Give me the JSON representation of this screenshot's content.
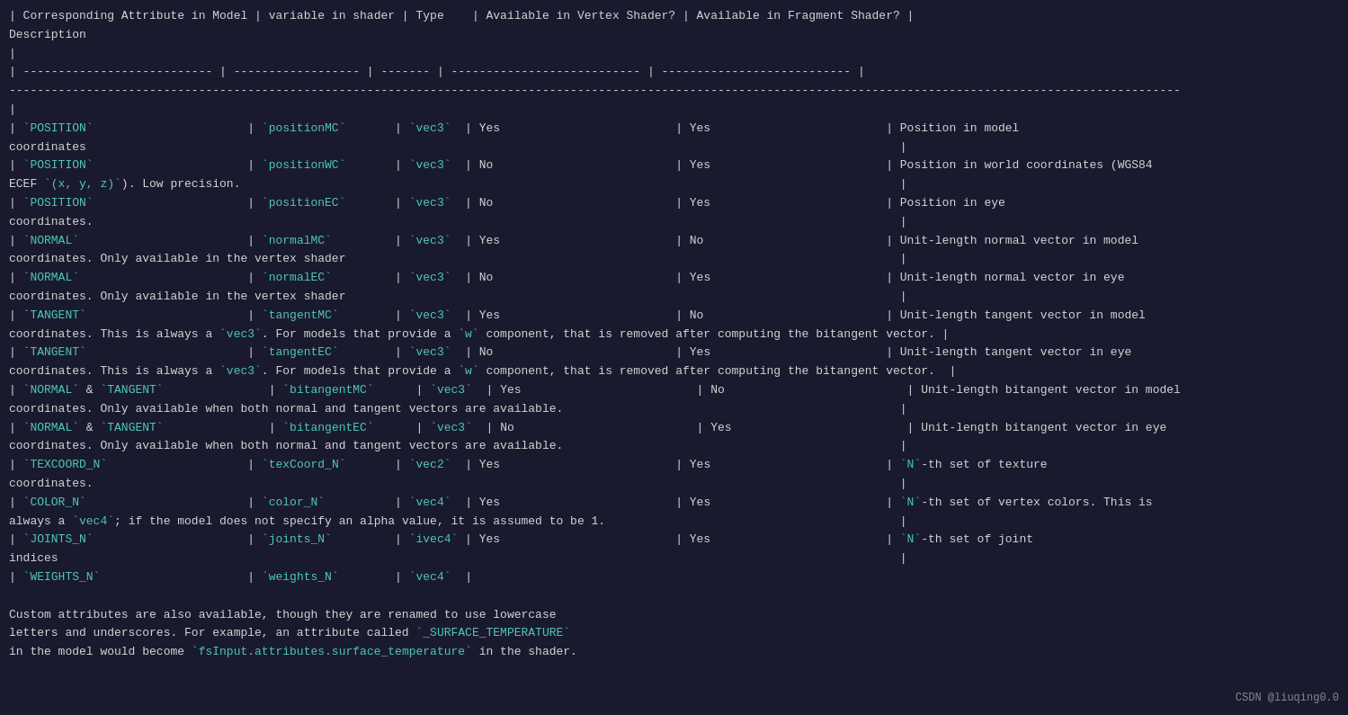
{
  "watermark": "CSDN @liuqing0.0",
  "content": {
    "header": "| Corresponding Attribute in Model | variable in shader | Type    | Available in Vertex Shader? | Available in Fragment Shader? |\nDescription",
    "sep1": "|\n| --------------------------- | ------------------ | ------- | --------------------------- | --------------------------- |",
    "sep2": "-----------------------------------------------------------------------------------------------------------------------------------------------------------------------",
    "blank": "|",
    "rows": [
      {
        "attr": "`POSITION`",
        "shader": "`positionMC`",
        "type": "`vec3`",
        "vertex": "Yes",
        "fragment": "Yes",
        "desc": "| Position in model coordinates                                                                     |"
      },
      {
        "attr": "`POSITION`",
        "shader": "`positionWC`",
        "type": "`vec3`",
        "vertex": "No",
        "fragment": "Yes",
        "desc": "| Position in world coordinates (WGS84 ECEF `(x, y, z)`). Low precision.                           |"
      },
      {
        "attr": "`POSITION`",
        "shader": "`positionEC`",
        "type": "`vec3`",
        "vertex": "No",
        "fragment": "Yes",
        "desc": "| Position in eye coordinates.                                                                      |"
      },
      {
        "attr": "`NORMAL`",
        "shader": "`normalMC`",
        "type": "`vec3`",
        "vertex": "Yes",
        "fragment": "No",
        "desc": "| Unit-length normal vector in model coordinates. Only available in the vertex shader               |"
      },
      {
        "attr": "`NORMAL`",
        "shader": "`normalEC`",
        "type": "`vec3`",
        "vertex": "No",
        "fragment": "Yes",
        "desc": "| Unit-length normal vector in eye coordinates. Only available in the vertex shader                 |"
      },
      {
        "attr": "`TANGENT`",
        "shader": "`tangentMC`",
        "type": "`vec3`",
        "vertex": "Yes",
        "fragment": "No",
        "desc": "| Unit-length tangent vector in model coordinates. This is always a `vec3`. For models that provide a `w` component, that is removed after computing the bitangent vector. |"
      },
      {
        "attr": "`TANGENT`",
        "shader": "`tangentEC`",
        "type": "`vec3`",
        "vertex": "No",
        "fragment": "Yes",
        "desc": "| Unit-length tangent vector in eye coordinates. This is always a `vec3`. For models that provide a `w` component, that is removed after computing the bitangent vector.  |"
      },
      {
        "attr": "`NORMAL` & `TANGENT`",
        "shader": "`bitangentMC`",
        "type": "`vec3`",
        "vertex": "Yes",
        "fragment": "No",
        "desc": "| Unit-length bitangent vector in model coordinates. Only available when both normal and tangent vectors are available.                                                   |"
      },
      {
        "attr": "`NORMAL` & `TANGENT`",
        "shader": "`bitangentEC`",
        "type": "`vec3`",
        "vertex": "No",
        "fragment": "Yes",
        "desc": "| Unit-length bitangent vector in eye coordinates. Only available when both normal and tangent vectors are available.                                                    |"
      },
      {
        "attr": "`TEXCOORD_N`",
        "shader": "`texCoord_N`",
        "type": "`vec2`",
        "vertex": "Yes",
        "fragment": "Yes",
        "desc": "| `N`-th set of texture coordinates.                                                                |"
      },
      {
        "attr": "`COLOR_N`",
        "shader": "`color_N`",
        "type": "`vec4`",
        "vertex": "Yes",
        "fragment": "Yes",
        "desc": "| `N`-th set of vertex colors. This is always a `vec4`; if the model does not specify an alpha value, it is assumed to be 1.                                            |"
      },
      {
        "attr": "`JOINTS_N`",
        "shader": "`joints_N`",
        "type": "`ivec4`",
        "vertex": "Yes",
        "fragment": "Yes",
        "desc": "| `N`-th set of joint indices                                                                       |"
      },
      {
        "attr": "`WEIGHTS_N`",
        "shader": "`weights_N`",
        "type": "`vec4`",
        "vertex": "",
        "fragment": "",
        "desc": "|"
      }
    ],
    "footer": "Custom attributes are also available, though they are renamed to use lowercase\nletters and underscores. For example, an attribute called `_SURFACE_TEMPERATURE`\nin the model would become `fsInput.attributes.surface_temperature` in the shader."
  }
}
